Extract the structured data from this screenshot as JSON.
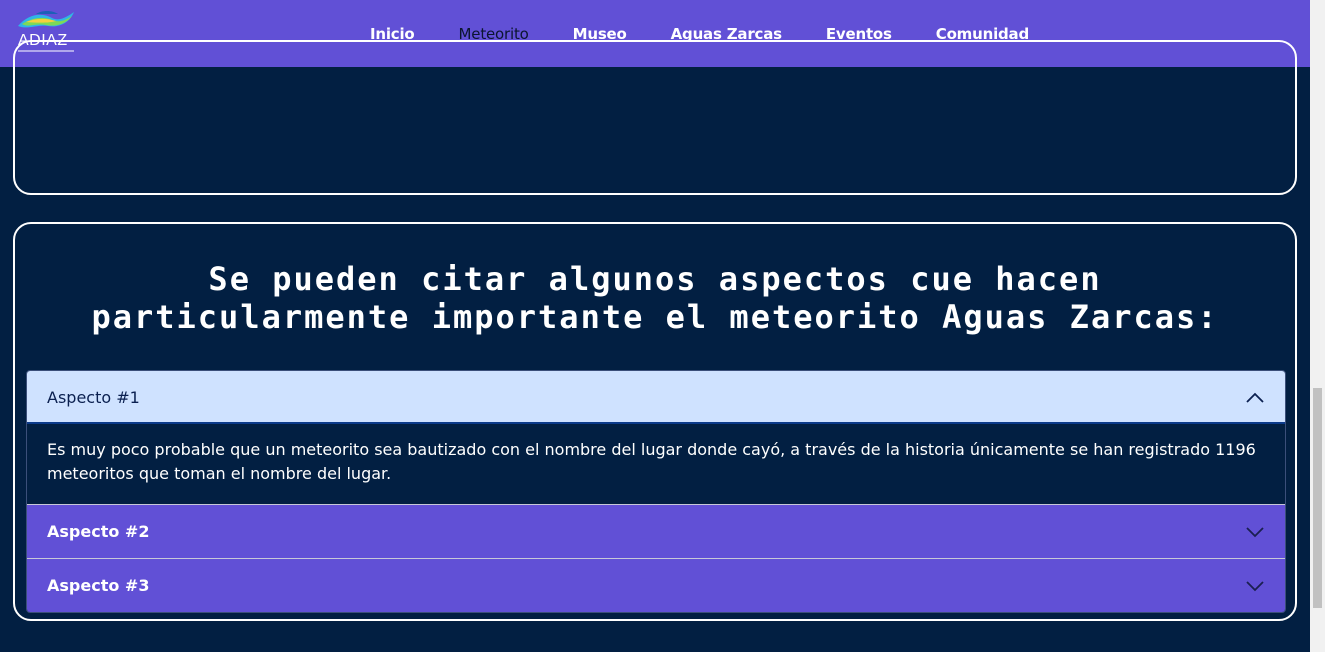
{
  "brand": {
    "logo_text": "ADIAZ",
    "colors": {
      "header": "#6150d6",
      "background": "#021f42",
      "accordion_open": "#cfe2ff"
    }
  },
  "nav": {
    "items": [
      {
        "label": "Inicio"
      },
      {
        "label": "Meteorito"
      },
      {
        "label": "Museo"
      },
      {
        "label": "Aguas Zarcas"
      },
      {
        "label": "Eventos"
      },
      {
        "label": "Comunidad"
      }
    ],
    "active": "Meteorito"
  },
  "section": {
    "heading": "Se pueden citar algunos aspectos cue hacen particularmente importante el meteorito Aguas Zarcas:"
  },
  "accordion": {
    "items": [
      {
        "title": "Aspecto #1",
        "expanded": true,
        "body": "Es muy poco probable que un meteorito sea bautizado con el nombre del lugar donde cayó, a través de la historia únicamente se han registrado 1196 meteoritos que toman el nombre del lugar."
      },
      {
        "title": "Aspecto #2",
        "expanded": false
      },
      {
        "title": "Aspecto #3",
        "expanded": false
      }
    ],
    "icons": {
      "expanded": "chevron-up-icon",
      "collapsed": "chevron-down-icon"
    }
  }
}
